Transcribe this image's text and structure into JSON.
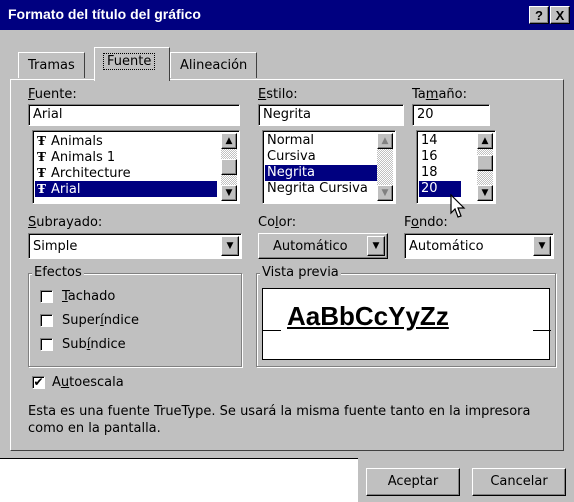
{
  "title": "Formato del título del gráfico",
  "title_buttons": {
    "help": "?",
    "close": "X"
  },
  "tabs": [
    "Tramas",
    "Fuente",
    "Alineación"
  ],
  "font": {
    "label": "Fuente:",
    "value": "Arial",
    "items": [
      "Animals",
      "Animals 1",
      "Architecture",
      "Arial"
    ],
    "selected": "Arial",
    "item_icon": "truetype-icon"
  },
  "style": {
    "label": "Estilo:",
    "value": "Negrita",
    "items": [
      "Normal",
      "Cursiva",
      "Negrita",
      "Negrita Cursiva"
    ],
    "selected": "Negrita"
  },
  "size": {
    "label": "Tamaño:",
    "value": "20",
    "items": [
      "14",
      "16",
      "18",
      "20"
    ],
    "selected": "20"
  },
  "underline": {
    "label": "Subrayado:",
    "value": "Simple"
  },
  "color": {
    "label": "Color:",
    "value": "Automático"
  },
  "background": {
    "label": "Fondo:",
    "value": "Automático"
  },
  "effects": {
    "legend": "Efectos",
    "items": [
      {
        "label": "Tachado",
        "checked": false
      },
      {
        "label": "Superíndice",
        "checked": false
      },
      {
        "label": "Subíndice",
        "checked": false
      }
    ]
  },
  "preview": {
    "legend": "Vista previa",
    "sample": "AaBbCcYyZz"
  },
  "autoscale": {
    "label": "Autoescala",
    "checked": true
  },
  "info": "Esta es una fuente TrueType. Se usará la misma fuente tanto en la impresora como en la pantalla.",
  "buttons": {
    "ok": "Aceptar",
    "cancel": "Cancelar"
  },
  "colors": {
    "titlebar": "#000080",
    "face": "#c0c0c0",
    "selection": "#000080"
  }
}
